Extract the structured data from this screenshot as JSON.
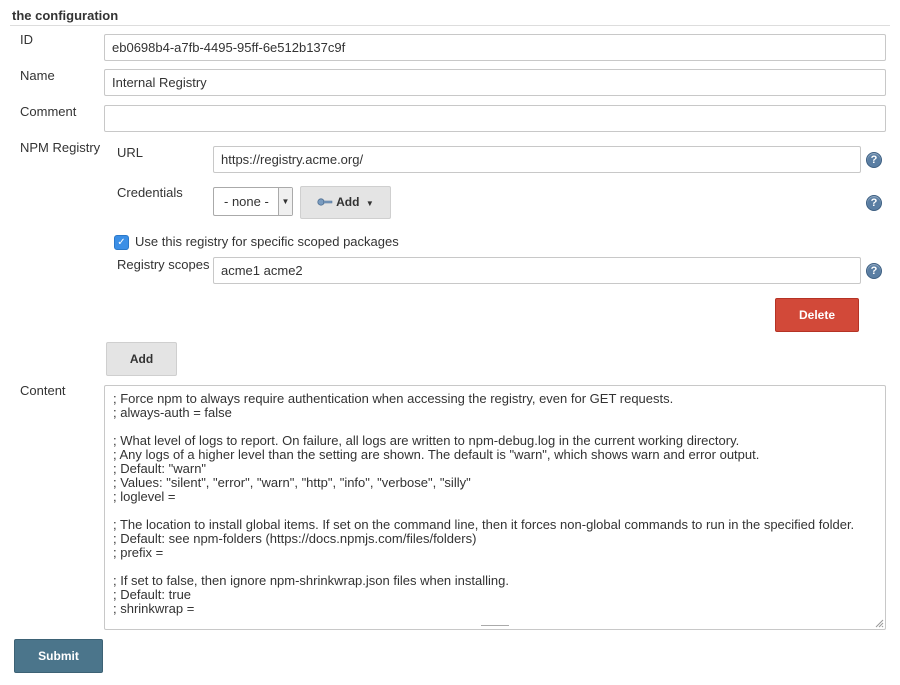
{
  "section": {
    "title": "the configuration"
  },
  "fields": {
    "id": {
      "label": "ID",
      "value": "eb0698b4-a7fb-4495-95ff-6e512b137c9f"
    },
    "name": {
      "label": "Name",
      "value": "Internal Registry"
    },
    "comment": {
      "label": "Comment",
      "value": ""
    }
  },
  "registry": {
    "label": "NPM Registry",
    "url": {
      "label": "URL",
      "value": "https://registry.acme.org/"
    },
    "credentials": {
      "label": "Credentials",
      "selected": "- none -",
      "add_label": "Add"
    },
    "scoped": {
      "checked": true,
      "label": "Use this registry for specific scoped packages"
    },
    "scopes": {
      "label": "Registry scopes",
      "value": "acme1 acme2"
    },
    "delete_label": "Delete",
    "help_glyph": "?"
  },
  "add_registry_label": "Add",
  "content": {
    "label": "Content",
    "lines": [
      "; Force npm to always require authentication when accessing the registry, even for GET requests.",
      "; always-auth = false",
      "",
      "; What level of logs to report. On failure, all logs are written to npm-debug.log in the current working directory.",
      "; Any logs of a higher level than the setting are shown. The default is \"warn\", which shows warn and error output.",
      "; Default: \"warn\"",
      "; Values: \"silent\", \"error\", \"warn\", \"http\", \"info\", \"verbose\", \"silly\"",
      "; loglevel =",
      "",
      "; The location to install global items. If set on the command line, then it forces non-global commands to run in the specified folder.",
      "; Default: see npm-folders (https://docs.npmjs.com/files/folders)",
      "; prefix =",
      "",
      "; If set to false, then ignore npm-shrinkwrap.json files when installing.",
      "; Default: true",
      "; shrinkwrap ="
    ]
  },
  "submit_label": "Submit",
  "icons": {
    "help": "help-icon",
    "key": "key-icon",
    "caret": "caret-down-icon",
    "check": "checkmark-icon"
  },
  "colors": {
    "delete": "#d24939",
    "submit": "#4b758b",
    "help": "#5a7ea3",
    "checkbox": "#3b8fe6"
  }
}
